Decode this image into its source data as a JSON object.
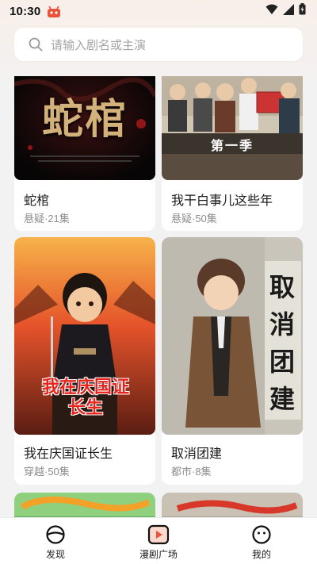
{
  "status_bar": {
    "time": "10:30"
  },
  "search": {
    "placeholder": "请输入剧名或主演"
  },
  "cards": [
    {
      "title": "蛇棺",
      "meta": "悬疑·21集",
      "cover_text": "蛇棺"
    },
    {
      "title": "我干白事儿这些年",
      "meta": "悬疑·50集",
      "cover_text": "第一季"
    },
    {
      "title": "我在庆国证长生",
      "meta": "穿越·50集",
      "cover_text": "我在庆国证长生"
    },
    {
      "title": "取消团建",
      "meta": "都市·8集",
      "cover_text": "取消团建"
    }
  ],
  "bottom_nav": {
    "items": [
      {
        "label": "发现",
        "icon": "discover-icon"
      },
      {
        "label": "漫剧广场",
        "icon": "play-square-icon"
      },
      {
        "label": "我的",
        "icon": "smiley-icon"
      }
    ]
  },
  "colors": {
    "accent": "#e8533b",
    "background": "#f3f2f2"
  }
}
